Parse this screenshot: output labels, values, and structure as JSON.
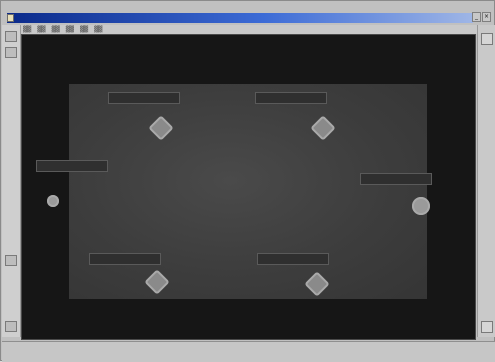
{
  "window": {
    "title": "",
    "minimize_label": "_",
    "close_label": "×"
  },
  "menubar": {
    "items": [
      "",
      "",
      "",
      "",
      "",
      ""
    ]
  },
  "left_strip": {
    "label": ""
  },
  "statusbar": {
    "text": ""
  }
}
